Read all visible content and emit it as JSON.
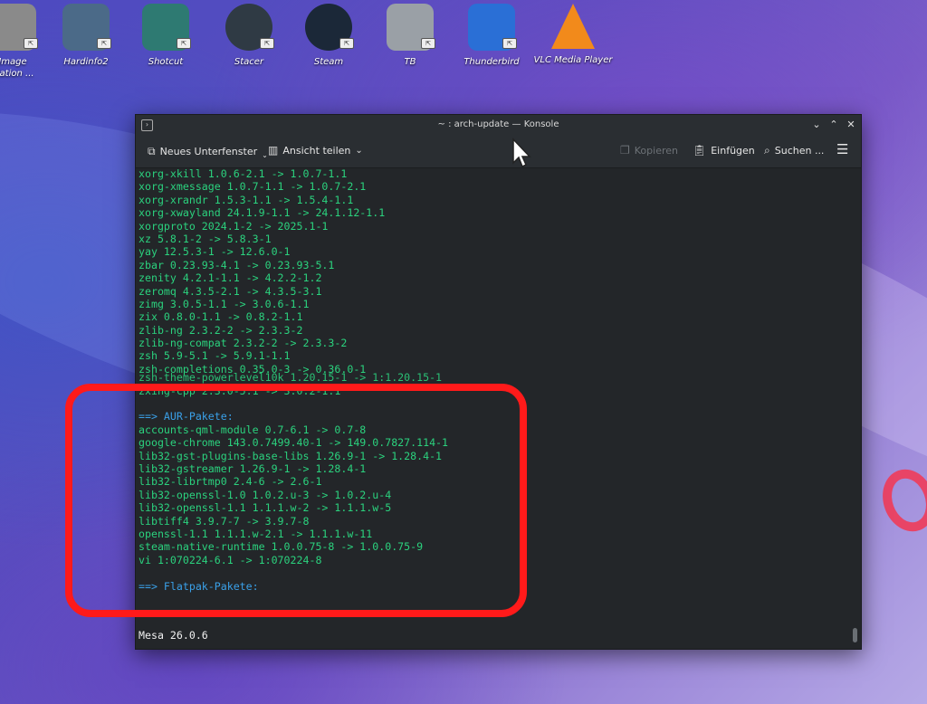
{
  "desktop": {
    "icons": [
      {
        "label": "Image\nulation ...",
        "color": "#8a8a8a",
        "icon": "gimp-icon"
      },
      {
        "label": "Hardinfo2",
        "color": "#4b6a88",
        "icon": "hardinfo-icon"
      },
      {
        "label": "Shotcut",
        "color": "#2e7a72",
        "icon": "shotcut-icon"
      },
      {
        "label": "Stacer",
        "color": "#2f3a44",
        "icon": "stacer-icon"
      },
      {
        "label": "Steam",
        "color": "#1b2838",
        "icon": "steam-icon"
      },
      {
        "label": "TB",
        "color": "#9aa0a6",
        "icon": "file-icon"
      },
      {
        "label": "Thunderbird",
        "color": "#2a6fd6",
        "icon": "thunderbird-icon"
      },
      {
        "label": "VLC Media Player",
        "color": "#f28a1b",
        "icon": "vlc-icon"
      }
    ]
  },
  "window": {
    "title": "~ : arch-update — Konsole",
    "toolbar": {
      "new_tab": "Neues Unterfenster",
      "split_view": "Ansicht teilen",
      "copy": "Kopieren",
      "paste": "Einfügen",
      "search": "Suchen ..."
    }
  },
  "terminal": {
    "lines": [
      {
        "text": "xorg-xkill 1.0.6-2.1 -> 1.0.7-1.1",
        "kind": "pkg"
      },
      {
        "text": "xorg-xmessage 1.0.7-1.1 -> 1.0.7-2.1",
        "kind": "pkg"
      },
      {
        "text": "xorg-xrandr 1.5.3-1.1 -> 1.5.4-1.1",
        "kind": "pkg"
      },
      {
        "text": "xorg-xwayland 24.1.9-1.1 -> 24.1.12-1.1",
        "kind": "pkg"
      },
      {
        "text": "xorgproto 2024.1-2 -> 2025.1-1",
        "kind": "pkg"
      },
      {
        "text": "xz 5.8.1-2 -> 5.8.3-1",
        "kind": "pkg"
      },
      {
        "text": "yay 12.5.3-1 -> 12.6.0-1",
        "kind": "pkg"
      },
      {
        "text": "zbar 0.23.93-4.1 -> 0.23.93-5.1",
        "kind": "pkg"
      },
      {
        "text": "zenity 4.2.1-1.1 -> 4.2.2-1.2",
        "kind": "pkg"
      },
      {
        "text": "zeromq 4.3.5-2.1 -> 4.3.5-3.1",
        "kind": "pkg"
      },
      {
        "text": "zimg 3.0.5-1.1 -> 3.0.6-1.1",
        "kind": "pkg"
      },
      {
        "text": "zix 0.8.0-1.1 -> 0.8.2-1.1",
        "kind": "pkg"
      },
      {
        "text": "zlib-ng 2.3.2-2 -> 2.3.3-2",
        "kind": "pkg"
      },
      {
        "text": "zlib-ng-compat 2.3.2-2 -> 2.3.3-2",
        "kind": "pkg"
      },
      {
        "text": "zsh 5.9-5.1 -> 5.9.1-1.1",
        "kind": "pkg"
      },
      {
        "text": "zsh-completions 0.35.0-3 -> 0.36.0-1",
        "kind": "pkg"
      },
      {
        "text": "zsh-theme-powerlevel10k 1.20.15-1 -> 1:1.20.15-1",
        "kind": "pkg"
      },
      {
        "text": "zxing-cpp 2.3.0-5.1 -> 3.0.2-1.1",
        "kind": "pkg"
      },
      {
        "text": "",
        "kind": "blank"
      },
      {
        "text": "==> AUR-Pakete:",
        "kind": "header"
      },
      {
        "text": "accounts-qml-module 0.7-6.1 -> 0.7-8",
        "kind": "pkg"
      },
      {
        "text": "google-chrome 143.0.7499.40-1 -> 149.0.7827.114-1",
        "kind": "pkg"
      },
      {
        "text": "lib32-gst-plugins-base-libs 1.26.9-1 -> 1.28.4-1",
        "kind": "pkg"
      },
      {
        "text": "lib32-gstreamer 1.26.9-1 -> 1.28.4-1",
        "kind": "pkg"
      },
      {
        "text": "lib32-librtmp0 2.4-6 -> 2.6-1",
        "kind": "pkg"
      },
      {
        "text": "lib32-openssl-1.0 1.0.2.u-3 -> 1.0.2.u-4",
        "kind": "pkg"
      },
      {
        "text": "lib32-openssl-1.1 1.1.1.w-2 -> 1.1.1.w-5",
        "kind": "pkg"
      },
      {
        "text": "libtiff4 3.9.7-7 -> 3.9.7-8",
        "kind": "pkg"
      },
      {
        "text": "openssl-1.1 1.1.1.w-2.1 -> 1.1.1.w-11",
        "kind": "pkg"
      },
      {
        "text": "steam-native-runtime 1.0.0.75-8 -> 1.0.0.75-9",
        "kind": "pkg"
      },
      {
        "text": "vi 1:070224-6.1 -> 1:070224-8",
        "kind": "pkg"
      },
      {
        "text": "",
        "kind": "blank"
      },
      {
        "text": "==> Flatpak-Pakete:",
        "kind": "header"
      }
    ],
    "bottom_line": "Mesa 26.0.6"
  },
  "colors": {
    "package_text": "#2bd27e",
    "header_text": "#3aa0e8",
    "highlight_box": "#ff1a1a"
  }
}
